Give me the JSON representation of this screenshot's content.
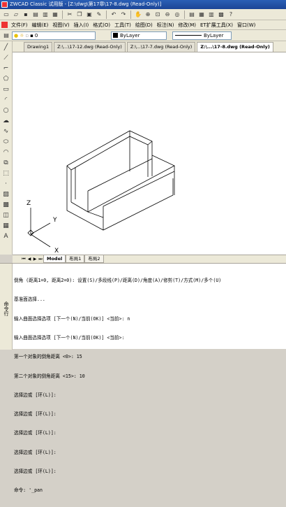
{
  "window": {
    "title": "ZWCAD Classic 试用版 - [Z:\\dwg\\第17章\\17-8.dwg (Read-Only)]"
  },
  "menubar": {
    "items": [
      "文件(F)",
      "编辑(E)",
      "视图(V)",
      "插入(I)",
      "格式(O)",
      "工具(T)",
      "绘图(D)",
      "标注(N)",
      "修改(M)",
      "ET扩展工具(X)",
      "窗口(W)"
    ]
  },
  "properties": {
    "layer": "0",
    "color": "ByLayer",
    "linetype": "ByLayer"
  },
  "doc_tabs": [
    {
      "label": "Drawing1"
    },
    {
      "label": "Z:\\...\\17-12.dwg (Read-Only)"
    },
    {
      "label": "Z:\\...\\17-7.dwg (Read-Only)"
    },
    {
      "label": "Z:\\...\\17-8.dwg (Read-Only)"
    }
  ],
  "ucs": {
    "x_label": "X",
    "y_label": "Y",
    "z_label": "Z"
  },
  "layout_tabs": [
    "Model",
    "布局1",
    "布局2"
  ],
  "command_panel": {
    "side_label": "命令行",
    "lines": [
      "倒角 (距离1=0, 距离2=0): 设置(S)/多段线(P)/距离(D)/角度(A)/修剪(T)/方式(M)/多个(U)",
      "基准面选择...",
      "输入曲面选择选项 [下一个(N)/当前(OK)] <当前>: n",
      "输入曲面选择选项 [下一个(N)/当前(OK)] <当前>:",
      "第一个对象的倒角距离 <0>: 15",
      "第二个对象的倒角距离 <15>: 10",
      "选择边或 [环(L)]:",
      "选择边或 [环(L)]:",
      "选择边或 [环(L)]:",
      "选择边或 [环(L)]:",
      "选择边或 [环(L)]:",
      "命令: '_pan"
    ]
  }
}
